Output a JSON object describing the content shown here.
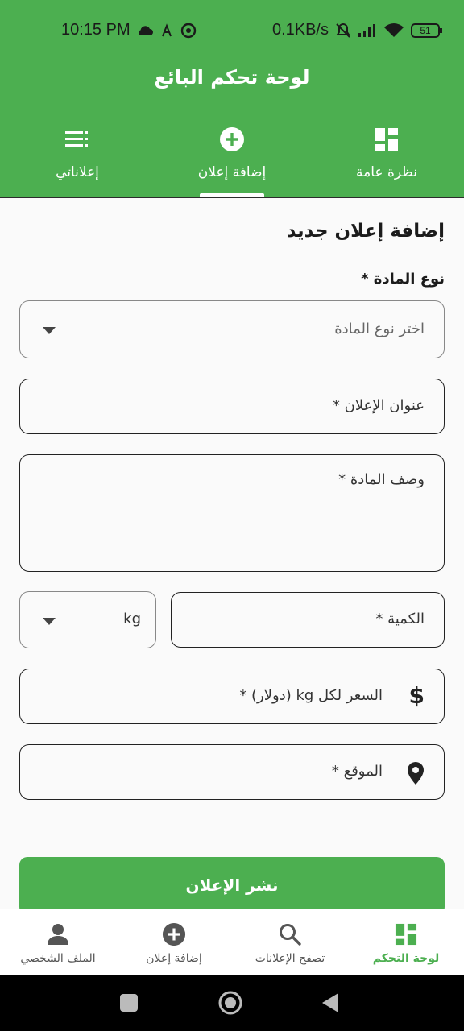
{
  "status_bar": {
    "time": "10:15 PM",
    "net_speed": "0.1KB/s",
    "battery": "51"
  },
  "app_bar": {
    "title": "لوحة تحكم البائع"
  },
  "tabs": [
    {
      "label": "نظرة عامة",
      "icon": "dashboard-icon",
      "active": false
    },
    {
      "label": "إضافة إعلان",
      "icon": "add-circle-icon",
      "active": true
    },
    {
      "label": "إعلاناتي",
      "icon": "list-icon",
      "active": false
    }
  ],
  "form": {
    "section_title": "إضافة إعلان جديد",
    "material_type_label": "نوع المادة *",
    "material_type_placeholder": "اختر نوع المادة",
    "ad_title_label": "عنوان الإعلان *",
    "description_label": "وصف المادة *",
    "quantity_label": "الكمية *",
    "unit_value": "kg",
    "price_label": "السعر لكل kg (دولار) *",
    "location_label": "الموقع *",
    "publish_button": "نشر الإعلان"
  },
  "bottom_nav": [
    {
      "label": "لوحة التحكم",
      "icon": "dashboard-icon",
      "active": true
    },
    {
      "label": "تصفح الإعلانات",
      "icon": "search-icon",
      "active": false
    },
    {
      "label": "إضافة إعلان",
      "icon": "add-circle-icon",
      "active": false
    },
    {
      "label": "الملف الشخصي",
      "icon": "person-icon",
      "active": false
    }
  ],
  "colors": {
    "primary": "#4caf50",
    "background": "#fafafa"
  }
}
